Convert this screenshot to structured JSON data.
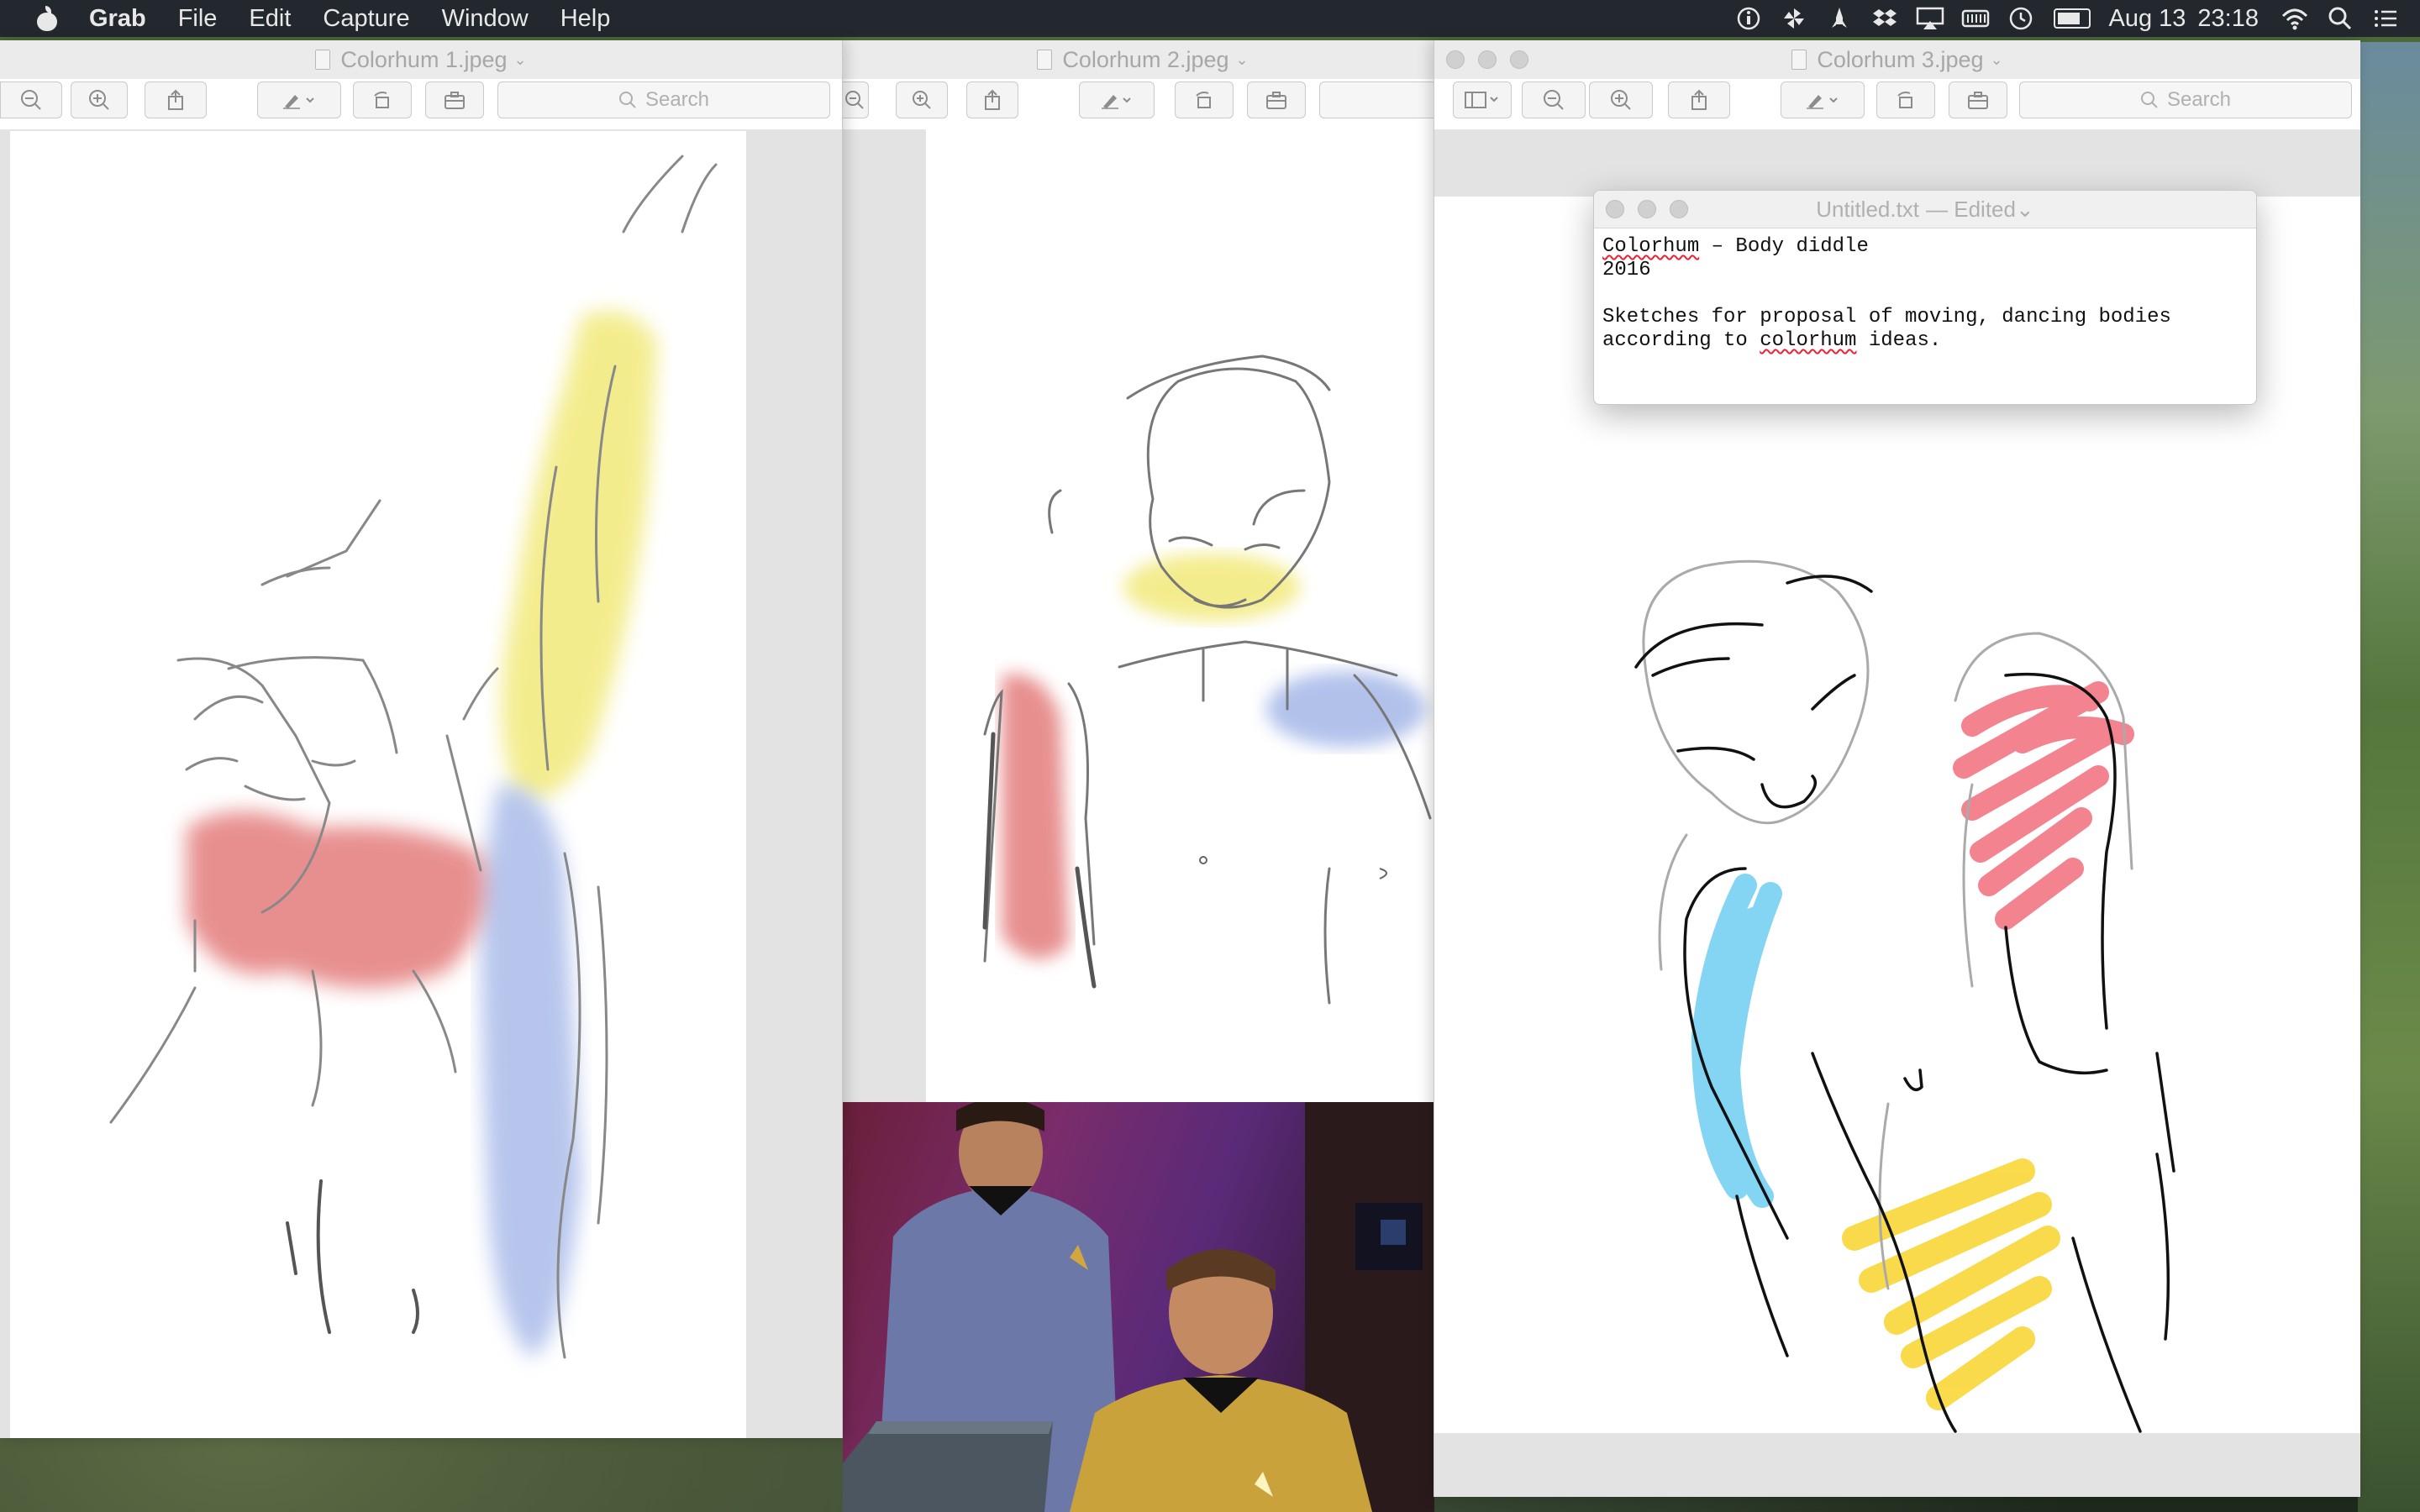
{
  "menubar": {
    "app_name": "Grab",
    "menus": [
      "File",
      "Edit",
      "Capture",
      "Window",
      "Help"
    ],
    "date": "Aug 13",
    "time": "23:18"
  },
  "windows": [
    {
      "title": "Colorhum 1.jpeg",
      "search_placeholder": "Search"
    },
    {
      "title": "Colorhum 2.jpeg",
      "search_placeholder": ""
    },
    {
      "title": "Colorhum 3.jpeg",
      "search_placeholder": "Search"
    }
  ],
  "textedit": {
    "filename": "Untitled.txt",
    "status": "— Edited",
    "word1": "Colorhum",
    "line1_rest": " – Body diddle",
    "line2": "2016",
    "line4": "Sketches for proposal of moving, dancing bodies",
    "line5_pre": "according to ",
    "line5_word": "colorhum",
    "line5_post": " ideas."
  },
  "colors": {
    "menubar_bg": "#23272e",
    "watercolor_yellow": "#f2e97a",
    "watercolor_red": "#e06a6a",
    "watercolor_blue": "#9fb2e6",
    "marker_cyan": "#5bc8f0",
    "marker_red": "#f05a6a",
    "marker_yellow": "#f7d21e"
  },
  "icons": [
    "apple-icon",
    "wifi-icon",
    "search-icon",
    "dropbox-icon",
    "airplay-icon",
    "battery-icon",
    "time-machine-icon",
    "notification-center-icon",
    "zoom-out-icon",
    "zoom-in-icon",
    "share-icon",
    "markup-icon",
    "rotate-icon",
    "toolbox-icon",
    "sidebar-icon"
  ]
}
